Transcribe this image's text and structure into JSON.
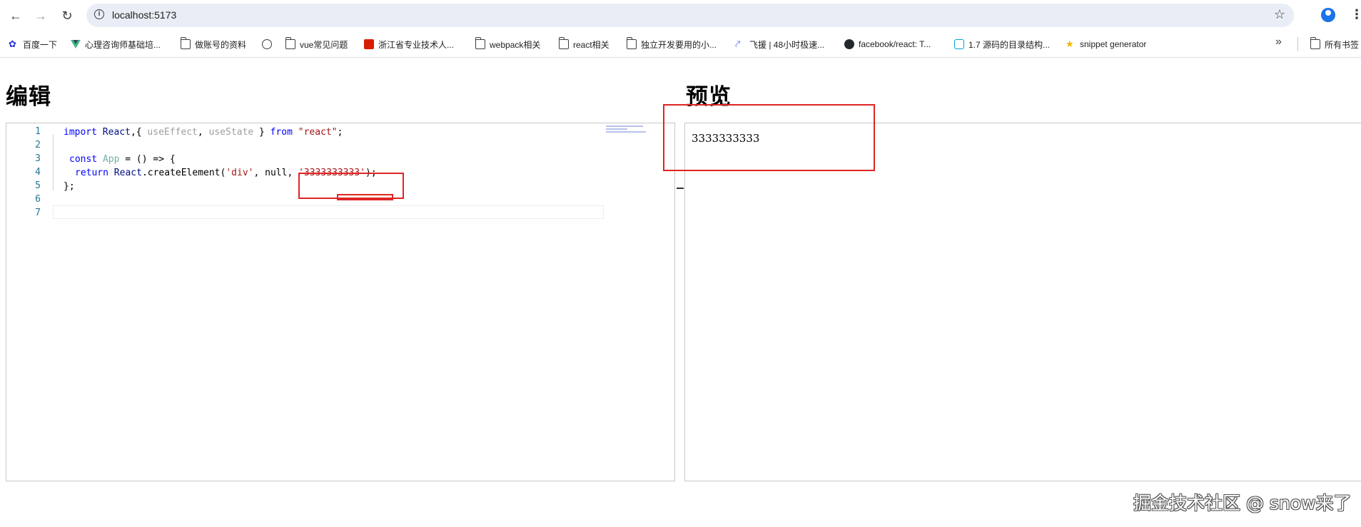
{
  "browser": {
    "url": "localhost:5173",
    "bookmarks": [
      {
        "label": "百度一下",
        "icon": "paw-icon",
        "color": "#2932e1"
      },
      {
        "label": "心理咨询师基础培...",
        "icon": "vue-logo-icon",
        "color": "#41b883"
      },
      {
        "label": "做账号的资料",
        "icon": "folder-icon"
      },
      {
        "label": "",
        "icon": "globe-icon"
      },
      {
        "label": "vue常见问题",
        "icon": "folder-icon"
      },
      {
        "label": "浙江省专业技术人...",
        "icon": "red-badge-icon",
        "color": "#d81e06"
      },
      {
        "label": "webpack相关",
        "icon": "folder-icon"
      },
      {
        "label": "react相关",
        "icon": "folder-icon"
      },
      {
        "label": "独立开发要用的小...",
        "icon": "folder-icon"
      },
      {
        "label": "飞援 | 48小时极速...",
        "icon": "arrow-icon",
        "color": "#5b6bff"
      },
      {
        "label": "facebook/react: T...",
        "icon": "github-icon"
      },
      {
        "label": "1.7 源码的目录结构...",
        "icon": "bilibili-icon",
        "color": "#00a1d6"
      },
      {
        "label": "snippet generator",
        "icon": "star-logo-icon",
        "color": "#f4b400"
      }
    ],
    "all_bookmarks": "所有书签"
  },
  "page": {
    "editor_heading": "编辑",
    "preview_heading": "预览",
    "preview_output": "3333333333"
  },
  "editor": {
    "line_numbers": [
      "1",
      "2",
      "3",
      "4",
      "5",
      "6",
      "7"
    ],
    "code": {
      "l2_import": "import",
      "l2_react": "React",
      "l2_brace_open": ",{ ",
      "l2_useEffect": "useEffect",
      "l2_comma": ", ",
      "l2_useState": "useState",
      "l2_brace_close": " } ",
      "l2_from": "from",
      "l2_module": "\"react\"",
      "l2_semi": ";",
      "l4_const": "const",
      "l4_app": "App",
      "l4_rest": " = () => {",
      "l5_return": "return",
      "l5_react": "React",
      "l5_call": ".createElement(",
      "l5_div": "'div'",
      "l5_null": ", null, ",
      "l5_value": "'3333333333'",
      "l5_end": ");",
      "l6_close": "};"
    }
  },
  "watermark": "掘金技术社区 @ snow来了",
  "colors": {
    "annotation_red": "#e02424",
    "keyword_blue": "#0000ff",
    "string_red": "#a31515",
    "line_number": "#237893"
  }
}
